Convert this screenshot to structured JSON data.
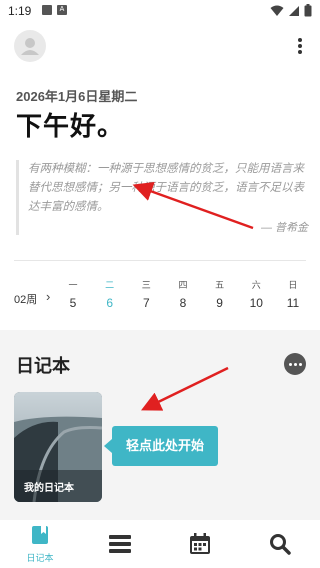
{
  "status": {
    "time": "1:19",
    "left_icons": [
      "notification-icon",
      "a-icon"
    ],
    "right_icons": [
      "wifi-icon",
      "signal-icon",
      "battery-icon"
    ]
  },
  "header": {
    "date": "2026年1月6日星期二",
    "greeting": "下午好。"
  },
  "quote": {
    "text": "有两种模糊：一种源于思想感情的贫乏，只能用语言来替代思想感情；另一种源于语言的贫乏，语言不足以表达丰富的感情。",
    "author": "— 普希金"
  },
  "week": {
    "label": "02周",
    "days": [
      {
        "name": "一",
        "num": "5",
        "active": false
      },
      {
        "name": "二",
        "num": "6",
        "active": true
      },
      {
        "name": "三",
        "num": "7",
        "active": false
      },
      {
        "name": "四",
        "num": "8",
        "active": false
      },
      {
        "name": "五",
        "num": "9",
        "active": false
      },
      {
        "name": "六",
        "num": "10",
        "active": false
      },
      {
        "name": "日",
        "num": "11",
        "active": false
      }
    ]
  },
  "diary": {
    "section_title": "日记本",
    "card_label": "我的日记本",
    "tip": "轻点此处开始"
  },
  "nav": {
    "items": [
      {
        "label": "日记本",
        "icon": "diary-book-icon",
        "active": true
      },
      {
        "label": "",
        "icon": "list-icon"
      },
      {
        "label": "",
        "icon": "calendar-icon"
      },
      {
        "label": "",
        "icon": "search-icon"
      }
    ]
  },
  "colors": {
    "accent": "#3fb6c6",
    "annotation": "#e02020"
  }
}
